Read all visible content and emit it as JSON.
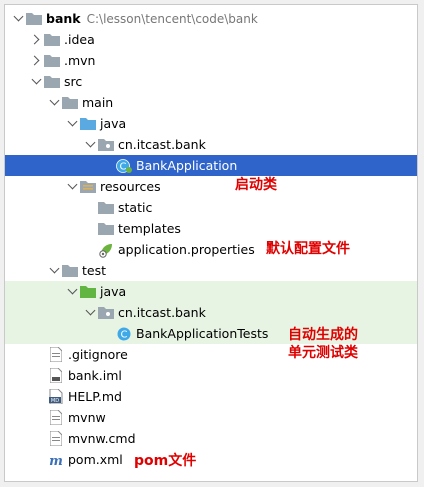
{
  "tree": {
    "root": {
      "name": "bank",
      "path": "C:\\lesson\\tencent\\code\\bank"
    },
    "idea": ".idea",
    "mvn": ".mvn",
    "src": "src",
    "main": "main",
    "main_java": "java",
    "main_pkg": "cn.itcast.bank",
    "bank_app": "BankApplication",
    "resources": "resources",
    "static": "static",
    "templates": "templates",
    "app_props": "application.properties",
    "test": "test",
    "test_java": "java",
    "test_pkg": "cn.itcast.bank",
    "bank_app_tests": "BankApplicationTests",
    "gitignore": ".gitignore",
    "bank_iml": "bank.iml",
    "help_md": "HELP.md",
    "mvnw": "mvnw",
    "mvnw_cmd": "mvnw.cmd",
    "pom": "pom.xml"
  },
  "annotations": {
    "startup_class": "启动类",
    "default_config": "默认配置文件",
    "auto_test_line1": "自动生成的",
    "auto_test_line2": "单元测试类",
    "pom_file": "pom文件"
  },
  "colors": {
    "selected": "#2f65ca",
    "annotation": "#e00000",
    "test_background": "#e7f3e3"
  }
}
